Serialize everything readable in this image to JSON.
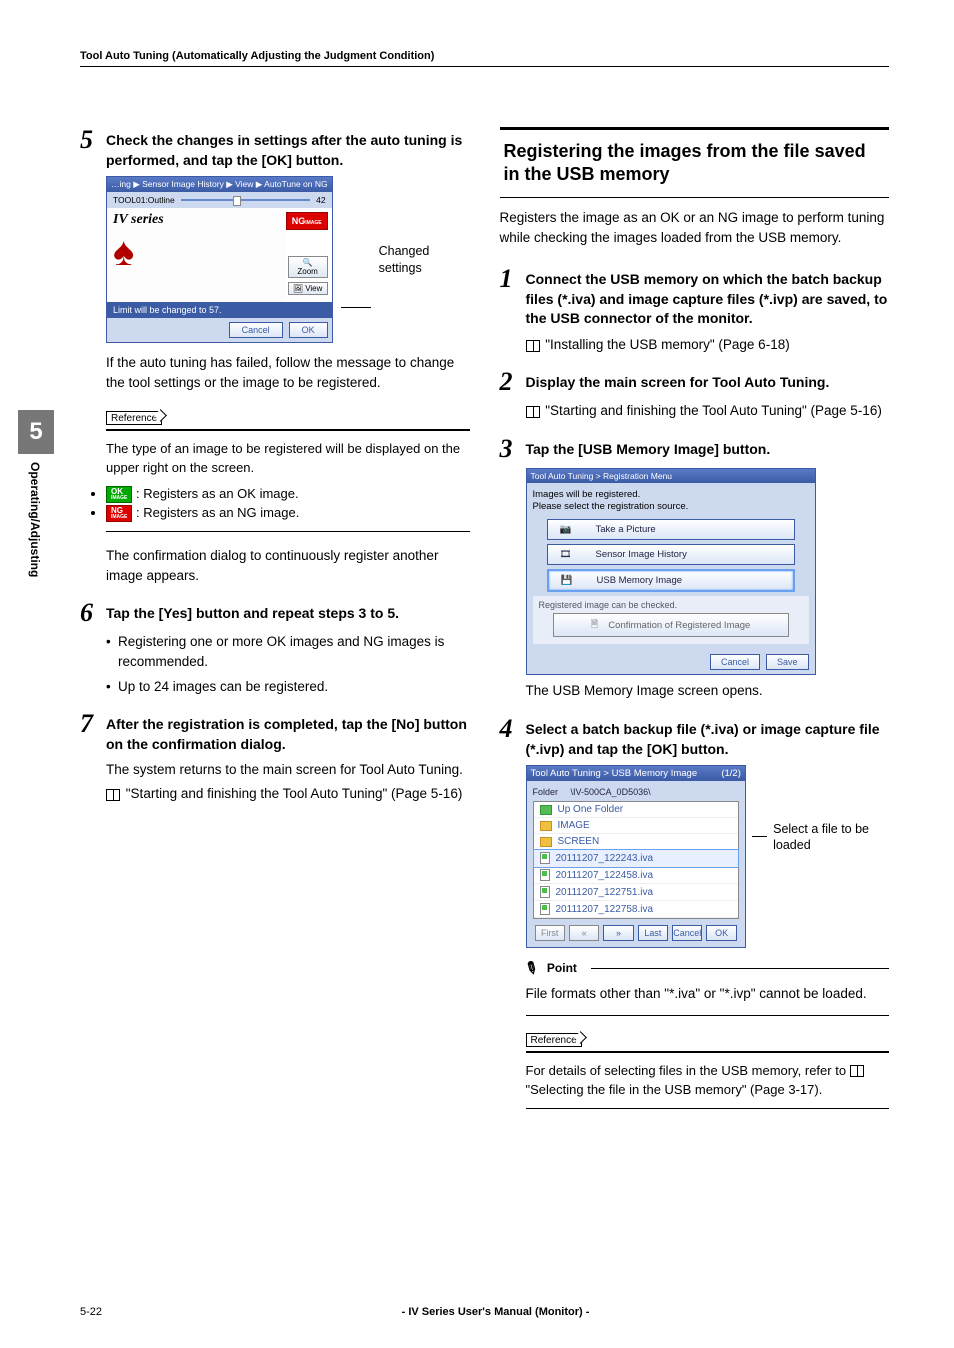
{
  "header": "Tool Auto Tuning (Automatically Adjusting the Judgment Condition)",
  "side_tab": {
    "num": "5",
    "text": "Operating/Adjusting"
  },
  "left": {
    "step5": {
      "num": "5",
      "text": "Check the changes in settings after the auto tuning is performed, and tap the [OK] button.",
      "scr": {
        "title": "…ing ▶ Sensor Image History ▶ View ▶ AutoTune on NG",
        "toolbar_label": "TOOL01:Outline",
        "toolbar_value": "42",
        "iv": "IV series",
        "ng": "NG",
        "ng_sub": "IMAGE",
        "zoom": "🔍 Zoom",
        "view": "🖼 View",
        "status": "Limit will be changed to 57.",
        "cancel": "Cancel",
        "ok": "OK"
      },
      "callout": "Changed settings",
      "after": "If the auto tuning has failed, follow the message to change the tool settings or the image to be registered.",
      "ref_label": "Reference",
      "ref_text": "The type of an image to be registered will be displayed on the upper right on the screen.",
      "ok_badge": "OK",
      "ok_badge_sub": "IMAGE",
      "ok_desc": " : Registers as an OK image.",
      "ng_badge": "NG",
      "ng_badge_sub": "IMAGE",
      "ng_desc": " : Registers as an NG image.",
      "confirm": "The confirmation dialog to continuously register another image appears."
    },
    "step6": {
      "num": "6",
      "text": "Tap the [Yes] button and repeat steps 3 to 5.",
      "b1": "Registering one or more OK images and NG images is recommended.",
      "b2": "Up to 24 images can be registered."
    },
    "step7": {
      "num": "7",
      "text": "After the registration is completed, tap the [No] button on the confirmation dialog.",
      "body": "The system returns to the main screen for Tool Auto Tuning.",
      "ref": " \"Starting and finishing the Tool Auto Tuning\" (Page 5-16)"
    }
  },
  "right": {
    "title": "Registering the images from the file saved in the USB memory",
    "intro": "Registers the image as an OK or an NG image to perform tuning while checking the images loaded from the USB memory.",
    "step1": {
      "num": "1",
      "text": "Connect the USB memory on which the batch backup files (*.iva) and image capture files (*.ivp) are saved, to the USB connector of the monitor.",
      "ref": " \"Installing the USB memory\" (Page 6-18)"
    },
    "step2": {
      "num": "2",
      "text": "Display the main screen for Tool Auto Tuning.",
      "ref": "  \"Starting and finishing the Tool Auto Tuning\" (Page 5-16)"
    },
    "step3": {
      "num": "3",
      "text": "Tap the [USB Memory Image] button.",
      "scr": {
        "title": "Tool Auto Tuning > Registration Menu",
        "msg1": "Images will be registered.",
        "msg2": "Please select the registration source.",
        "btn1": "Take a Picture",
        "btn2": "Sensor Image History",
        "btn3": "USB Memory Image",
        "sub_msg": "Registered image can be checked.",
        "btn4": "Confirmation of Registered Image",
        "cancel": "Cancel",
        "save": "Save"
      },
      "caption": "The USB Memory Image screen opens."
    },
    "step4": {
      "num": "4",
      "text": "Select a batch backup file (*.iva) or image capture file (*.ivp) and tap the [OK] button.",
      "scr": {
        "title": "Tool Auto Tuning > USB Memory Image",
        "page": "(1/2)",
        "folder_label": "Folder",
        "folder_path": "\\IV-500CA_0D5036\\",
        "items": [
          "Up One Folder",
          "IMAGE",
          "SCREEN",
          "20111207_122243.iva",
          "20111207_122458.iva",
          "20111207_122751.iva",
          "20111207_122758.iva"
        ],
        "btns": [
          "First",
          "«",
          "»",
          "Last",
          "Cancel",
          "OK"
        ]
      },
      "callout": "Select a file to be loaded",
      "point_label": "Point",
      "point": "File formats other than \"*.iva\" or \"*.ivp\" cannot be loaded.",
      "ref_label": "Reference",
      "ref": "For details of selecting files in the USB memory, refer to ",
      "ref2": " \"Selecting the file in the USB memory\" (Page 3-17)."
    }
  },
  "footer": {
    "left": "5-22",
    "center": "- IV Series User's Manual (Monitor) -"
  }
}
